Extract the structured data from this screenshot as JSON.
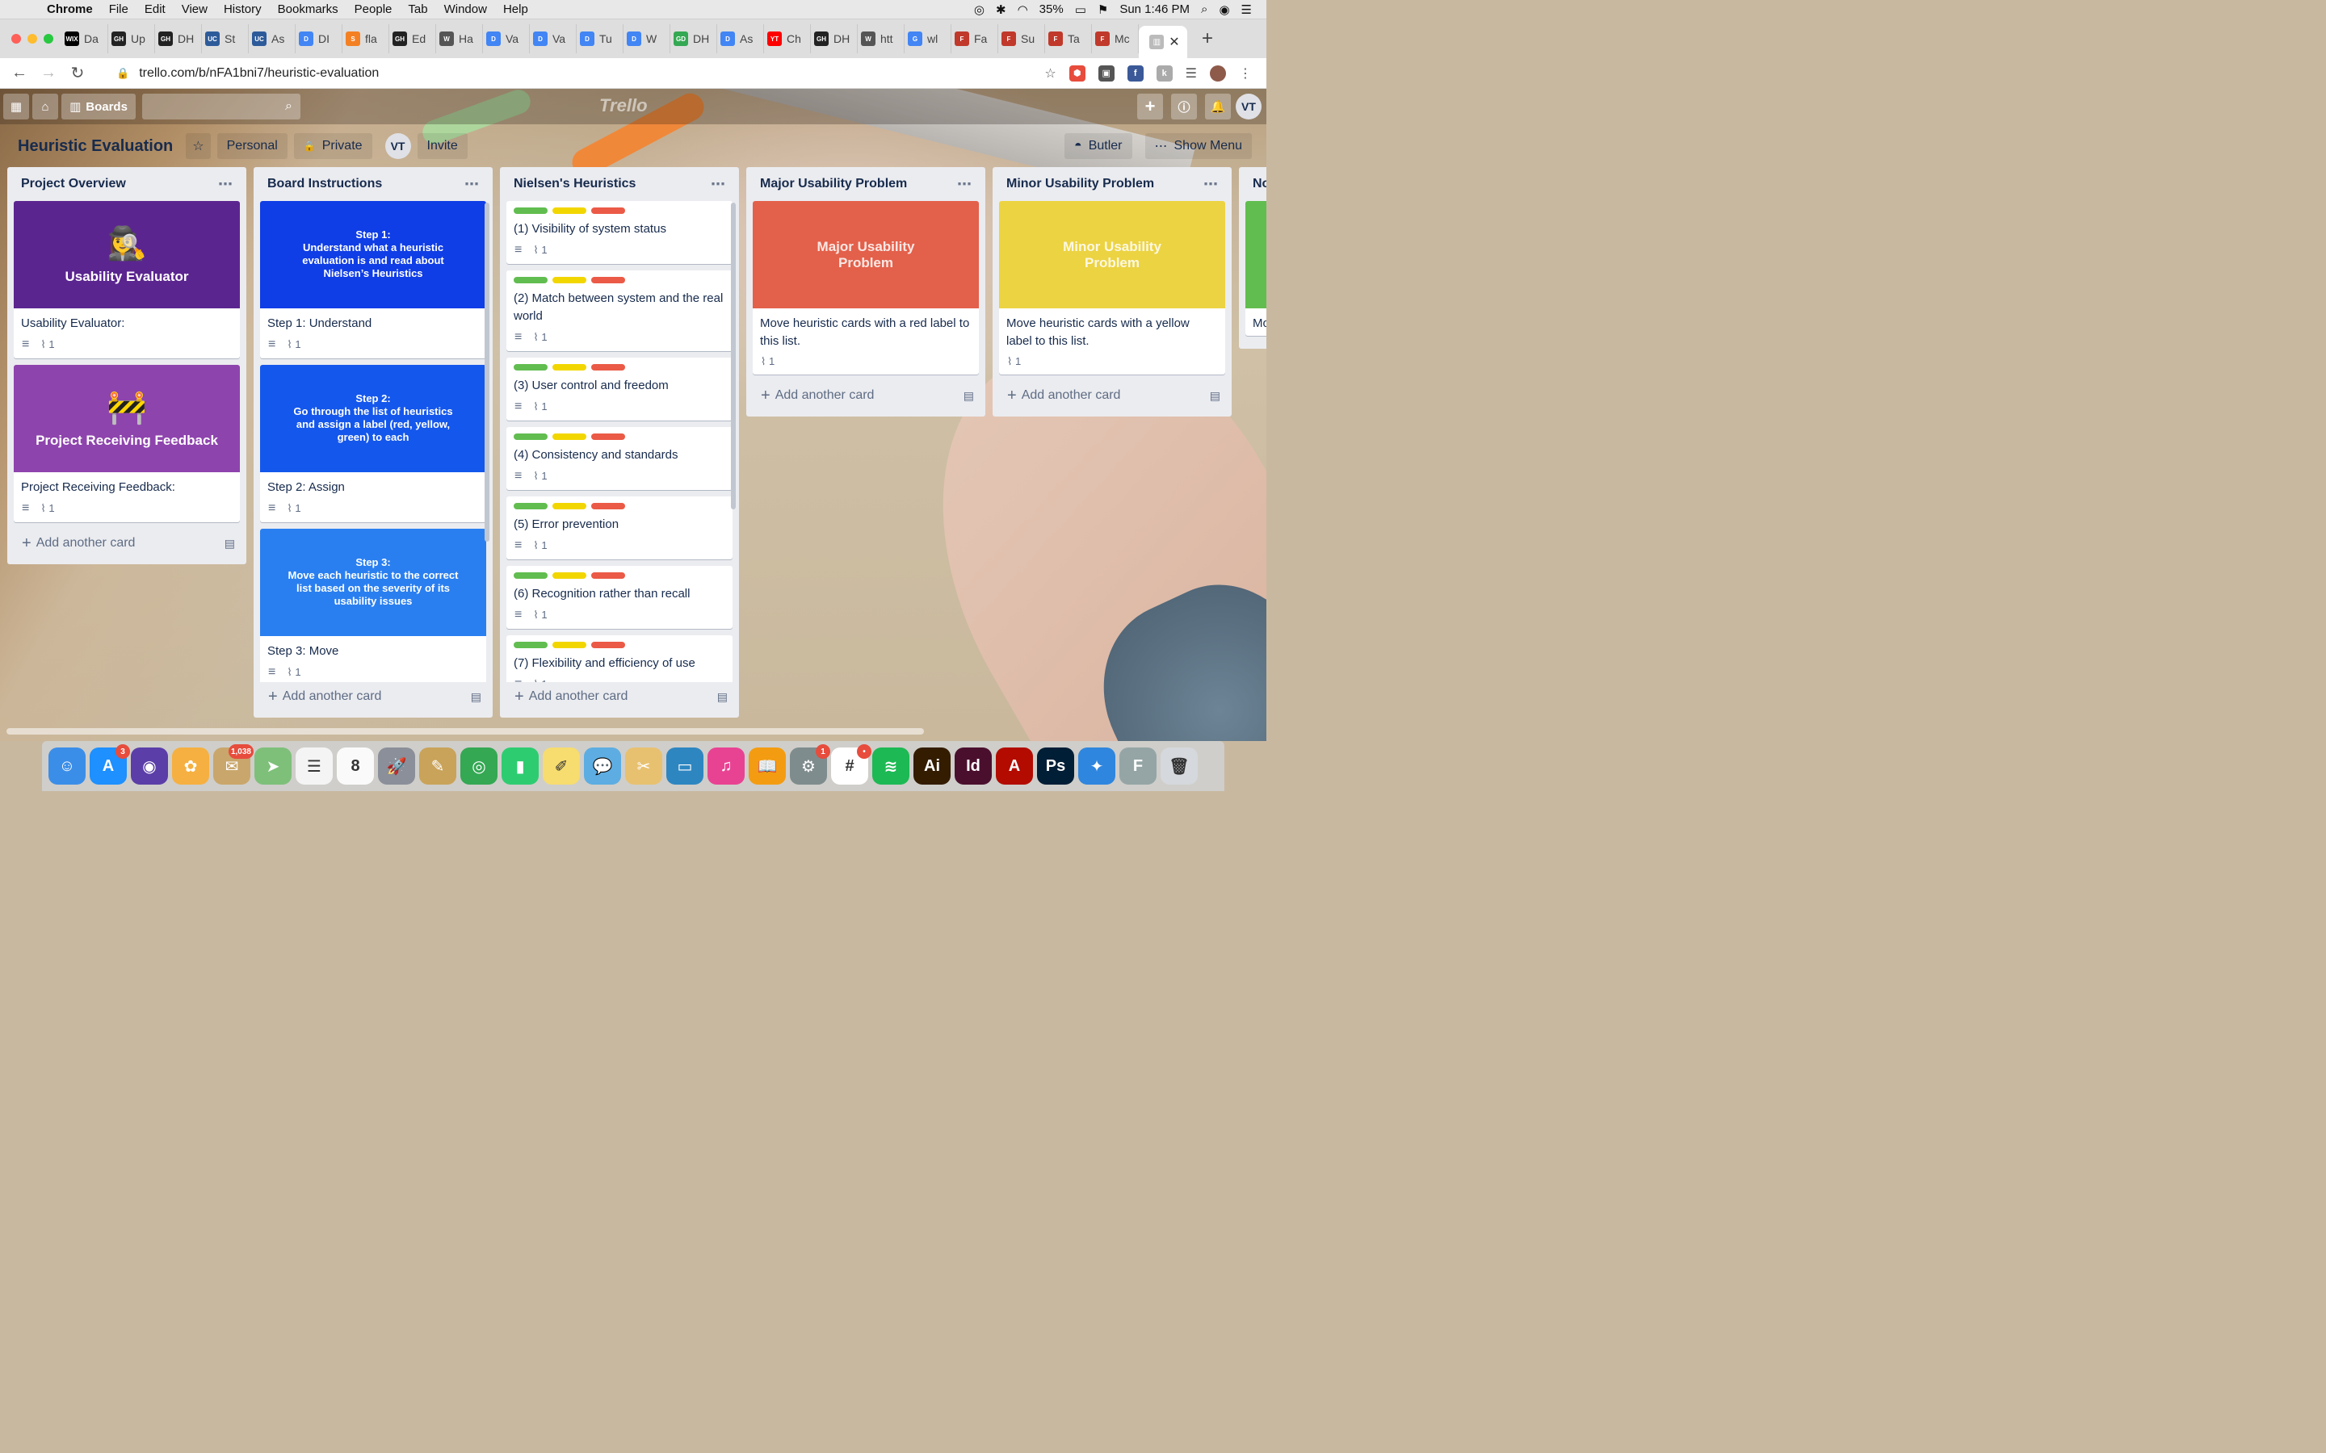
{
  "menubar": {
    "app": "Chrome",
    "items": [
      "File",
      "Edit",
      "View",
      "History",
      "Bookmarks",
      "People",
      "Tab",
      "Window",
      "Help"
    ],
    "battery": "35%",
    "clock": "Sun 1:46 PM"
  },
  "tabs": [
    {
      "fav": "WIX",
      "label": "Da",
      "color": "#000000"
    },
    {
      "fav": "GH",
      "label": "Up",
      "color": "#222222"
    },
    {
      "fav": "GH",
      "label": "DH",
      "color": "#222222"
    },
    {
      "fav": "UC",
      "label": "St",
      "color": "#2d5b9a"
    },
    {
      "fav": "UC",
      "label": "As",
      "color": "#2d5b9a"
    },
    {
      "fav": "D",
      "label": "DI",
      "color": "#4285f4"
    },
    {
      "fav": "S",
      "label": "fla",
      "color": "#f48024"
    },
    {
      "fav": "GH",
      "label": "Ed",
      "color": "#222222"
    },
    {
      "fav": "W",
      "label": "Ha",
      "color": "#555555"
    },
    {
      "fav": "D",
      "label": "Va",
      "color": "#4285f4"
    },
    {
      "fav": "D",
      "label": "Va",
      "color": "#4285f4"
    },
    {
      "fav": "D",
      "label": "Tu",
      "color": "#4285f4"
    },
    {
      "fav": "D",
      "label": "W",
      "color": "#4285f4"
    },
    {
      "fav": "GD",
      "label": "DH",
      "color": "#34a853"
    },
    {
      "fav": "D",
      "label": "As",
      "color": "#4285f4"
    },
    {
      "fav": "YT",
      "label": "Ch",
      "color": "#ff0000"
    },
    {
      "fav": "GH",
      "label": "DH",
      "color": "#222222"
    },
    {
      "fav": "W",
      "label": "htt",
      "color": "#555555"
    },
    {
      "fav": "G",
      "label": "wl",
      "color": "#4285f4"
    },
    {
      "fav": "F",
      "label": "Fa",
      "color": "#c0392b"
    },
    {
      "fav": "F",
      "label": "Su",
      "color": "#c0392b"
    },
    {
      "fav": "F",
      "label": "Ta",
      "color": "#c0392b"
    },
    {
      "fav": "F",
      "label": "Mc",
      "color": "#c0392b"
    }
  ],
  "address": {
    "url": "trello.com/b/nFA1bni7/heuristic-evaluation"
  },
  "header": {
    "boards_label": "Boards",
    "logo": "Trello",
    "avatar": "VT"
  },
  "board": {
    "title": "Heuristic Evaluation",
    "team": "Personal",
    "visibility": "Private",
    "member": "VT",
    "invite": "Invite",
    "butler": "Butler",
    "show_menu": "Show Menu"
  },
  "colors": {
    "label_green": "#61bd4f",
    "label_yellow": "#f2d600",
    "label_red": "#eb5a46"
  },
  "add_card": "Add another card",
  "lists": [
    {
      "title": "Project Overview",
      "cards": [
        {
          "cover_color": "#5b2590",
          "cover_emoji": "🕵️‍♀️",
          "cover_title": "Usability Evaluator",
          "title": "Usability Evaluator:",
          "attachments": "1"
        },
        {
          "cover_color": "#8e44ad",
          "cover_emoji": "🚧",
          "cover_title": "Project Receiving Feedback",
          "title": "Project Receiving Feedback:",
          "attachments": "1"
        }
      ]
    },
    {
      "title": "Board Instructions",
      "cards": [
        {
          "cover_color": "#0f3de6",
          "step_heading": "Step 1:",
          "step_text": "Understand what a heuristic evaluation is and read about Nielsen’s Heuristics",
          "title": "Step 1: Understand",
          "attachments": "1"
        },
        {
          "cover_color": "#1457ec",
          "step_heading": "Step 2:",
          "step_text": "Go through the list of heuristics and assign a label (red, yellow, green) to each",
          "title": "Step 2: Assign",
          "attachments": "1"
        },
        {
          "cover_color": "#2a7ff0",
          "step_heading": "Step 3:",
          "step_text": "Move each heuristic to the correct list based on the severity of its usability issues",
          "title": "Step 3: Move",
          "attachments": "1"
        }
      ]
    },
    {
      "title": "Nielsen's Heuristics",
      "cards": [
        {
          "title": "(1) Visibility of system status",
          "attachments": "1"
        },
        {
          "title": "(2) Match between system and the real world",
          "attachments": "1"
        },
        {
          "title": "(3) User control and freedom",
          "attachments": "1"
        },
        {
          "title": "(4) Consistency and standards",
          "attachments": "1"
        },
        {
          "title": "(5) Error prevention",
          "attachments": "1"
        },
        {
          "title": "(6) Recognition rather than recall",
          "attachments": "1"
        },
        {
          "title": "(7) Flexibility and efficiency of use",
          "attachments": "1"
        }
      ]
    },
    {
      "title": "Major Usability Problem",
      "cards": [
        {
          "cover_color": "#e3604a",
          "cover_title": "Major Usability Problem",
          "title": "Move heuristic cards with a red label to this list.",
          "attachments": "1"
        }
      ]
    },
    {
      "title": "Minor Usability Problem",
      "cards": [
        {
          "cover_color": "#ecd342",
          "cover_title": "Minor Usability Problem",
          "title": "Move heuristic cards with a yellow label to this list.",
          "attachments": "1"
        }
      ]
    },
    {
      "title": "No",
      "cards": [
        {
          "cover_color": "#61bd4f",
          "title": "Mo lab",
          "attachments": ""
        }
      ]
    }
  ],
  "dock": [
    {
      "name": "finder",
      "color": "#3b8ee8",
      "glyph": "☺",
      "badge": ""
    },
    {
      "name": "app-store",
      "color": "#1e90ff",
      "glyph": "A",
      "badge": "3"
    },
    {
      "name": "siri",
      "color": "#5b3ea8",
      "glyph": "◉",
      "badge": ""
    },
    {
      "name": "photos",
      "color": "#f5b041",
      "glyph": "✿",
      "badge": ""
    },
    {
      "name": "mail",
      "color": "#c9a66b",
      "glyph": "✉",
      "badge": "1,038"
    },
    {
      "name": "maps",
      "color": "#7ec07a",
      "glyph": "➤",
      "badge": ""
    },
    {
      "name": "reminders",
      "color": "#f4f4f4",
      "glyph": "☰",
      "badge": ""
    },
    {
      "name": "calendar",
      "color": "#fafafa",
      "glyph": "8",
      "badge": ""
    },
    {
      "name": "launchpad",
      "color": "#8a8f99",
      "glyph": "🚀",
      "badge": ""
    },
    {
      "name": "notes-app",
      "color": "#c9a35a",
      "glyph": "✎",
      "badge": ""
    },
    {
      "name": "chrome",
      "color": "#34a853",
      "glyph": "◎",
      "badge": ""
    },
    {
      "name": "numbers",
      "color": "#2ecc71",
      "glyph": "▮",
      "badge": ""
    },
    {
      "name": "notes",
      "color": "#f7dc6f",
      "glyph": "✐",
      "badge": ""
    },
    {
      "name": "messages",
      "color": "#5dade2",
      "glyph": "💬",
      "badge": ""
    },
    {
      "name": "preview",
      "color": "#e8c170",
      "glyph": "✂",
      "badge": ""
    },
    {
      "name": "keynote",
      "color": "#2e86c1",
      "glyph": "▭",
      "badge": ""
    },
    {
      "name": "itunes",
      "color": "#e84393",
      "glyph": "♫",
      "badge": ""
    },
    {
      "name": "books",
      "color": "#f39c12",
      "glyph": "📖",
      "badge": ""
    },
    {
      "name": "system-preferences",
      "color": "#7f8c8d",
      "glyph": "⚙",
      "badge": "1"
    },
    {
      "name": "slack",
      "color": "#ffffff",
      "glyph": "#",
      "badge": "•"
    },
    {
      "name": "spotify",
      "color": "#1db954",
      "glyph": "≋",
      "badge": ""
    },
    {
      "name": "illustrator",
      "color": "#331c00",
      "glyph": "Ai",
      "badge": ""
    },
    {
      "name": "indesign",
      "color": "#4b0f2e",
      "glyph": "Id",
      "badge": ""
    },
    {
      "name": "acrobat",
      "color": "#b30b00",
      "glyph": "A",
      "badge": ""
    },
    {
      "name": "photoshop",
      "color": "#001e36",
      "glyph": "Ps",
      "badge": ""
    },
    {
      "name": "safari",
      "color": "#2e86de",
      "glyph": "✦",
      "badge": ""
    },
    {
      "name": "font-book",
      "color": "#95a5a6",
      "glyph": "F",
      "badge": ""
    },
    {
      "name": "trash",
      "color": "#d5d8dc",
      "glyph": "🗑",
      "badge": ""
    }
  ]
}
